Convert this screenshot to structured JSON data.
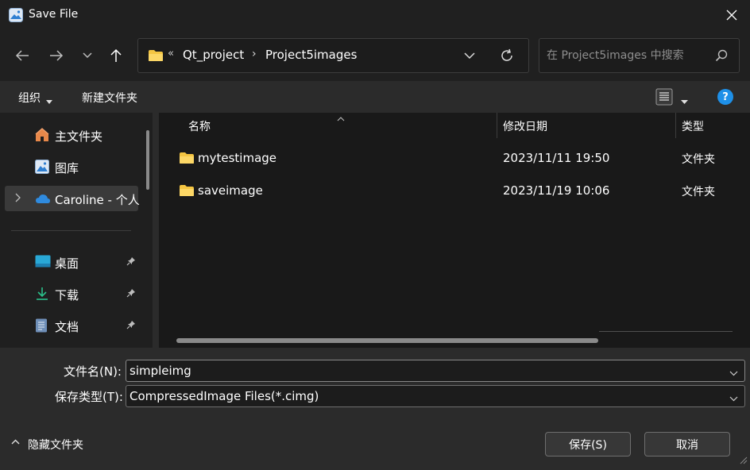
{
  "window": {
    "title": "Save File"
  },
  "address": {
    "overflow": "«",
    "crumbs": [
      "Qt_project",
      "Project5images"
    ]
  },
  "search": {
    "placeholder": "在 Project5images 中搜索"
  },
  "toolbar": {
    "organize_label": "组织",
    "new_folder_label": "新建文件夹",
    "help": "?"
  },
  "sidebar": {
    "items": [
      {
        "label": "主文件夹",
        "icon": "home-icon"
      },
      {
        "label": "图库",
        "icon": "gallery-icon"
      },
      {
        "label": "Caroline - 个人",
        "icon": "onedrive-cloud-icon"
      },
      {
        "label": "桌面",
        "icon": "desktop-icon"
      },
      {
        "label": "下载",
        "icon": "download-icon"
      },
      {
        "label": "文档",
        "icon": "document-icon"
      }
    ]
  },
  "files": {
    "columns": {
      "name": "名称",
      "date": "修改日期",
      "type": "类型"
    },
    "rows": [
      {
        "name": "mytestimage",
        "date": "2023/11/11 19:50",
        "type": "文件夹"
      },
      {
        "name": "saveimage",
        "date": "2023/11/19 10:06",
        "type": "文件夹"
      }
    ]
  },
  "form": {
    "filename_label": "文件名(N):",
    "filename_value": "simpleimg",
    "filetype_label": "保存类型(T):",
    "filetype_value": "CompressedImage Files(*.cimg)"
  },
  "footer": {
    "hide_folders_label": "隐藏文件夹",
    "save_label": "保存(S)",
    "cancel_label": "取消"
  },
  "colors": {
    "accent": "#1e90e8",
    "folder": "#f4c542",
    "background": "#202020"
  }
}
